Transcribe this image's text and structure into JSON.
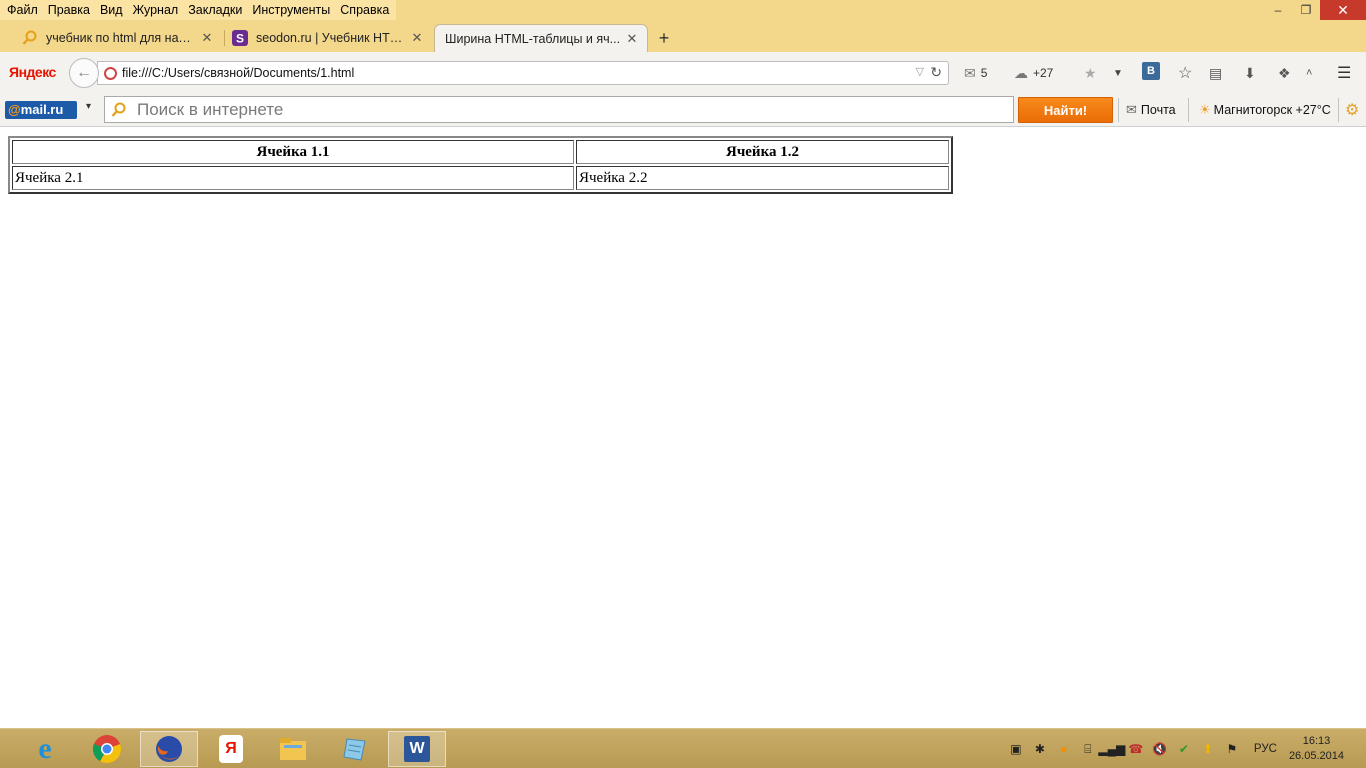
{
  "menu": [
    "Файл",
    "Правка",
    "Вид",
    "Журнал",
    "Закладки",
    "Инструменты",
    "Справка"
  ],
  "window_controls": {
    "minimize": "‒",
    "maximize": "❐",
    "close": "✕"
  },
  "tabs": [
    {
      "title": "учебник по html для начи...",
      "icon": "yandex-search-icon",
      "active": false
    },
    {
      "title": "seodon.ru | Учебник HTM...",
      "icon": "seodon-favicon",
      "active": false
    },
    {
      "title": "Ширина HTML-таблицы и яч...",
      "icon": "",
      "active": true
    }
  ],
  "new_tab": "+",
  "navbar": {
    "logo": "Яндекс",
    "url": "file:///C:/Users/связной/Documents/1.html",
    "mail_count": "5",
    "weather_temp": "+27"
  },
  "mailru": {
    "logo_at": "@",
    "logo_text": "mail.ru",
    "search_placeholder": "Поиск в интернете",
    "find_button": "Найти!",
    "mail_link": "Почта",
    "weather": "Магнитогорск +27°C"
  },
  "table": {
    "headers": [
      "Ячейка 1.1",
      "Ячейка 1.2"
    ],
    "rows": [
      [
        "Ячейка 2.1",
        "Ячейка 2.2"
      ]
    ]
  },
  "taskbar": {
    "apps": [
      "internet-explorer-icon",
      "chrome-icon",
      "firefox-icon",
      "yandex-browser-icon",
      "file-explorer-icon",
      "notepad-icon",
      "word-icon"
    ],
    "lang": "РУС",
    "time": "16:13",
    "date": "26.05.2014"
  },
  "colors": {
    "chrome_bg": "#f3d78b",
    "find_button": "#f17c0f",
    "mailru_blue": "#1d5aa8",
    "close_red": "#c7392a"
  }
}
